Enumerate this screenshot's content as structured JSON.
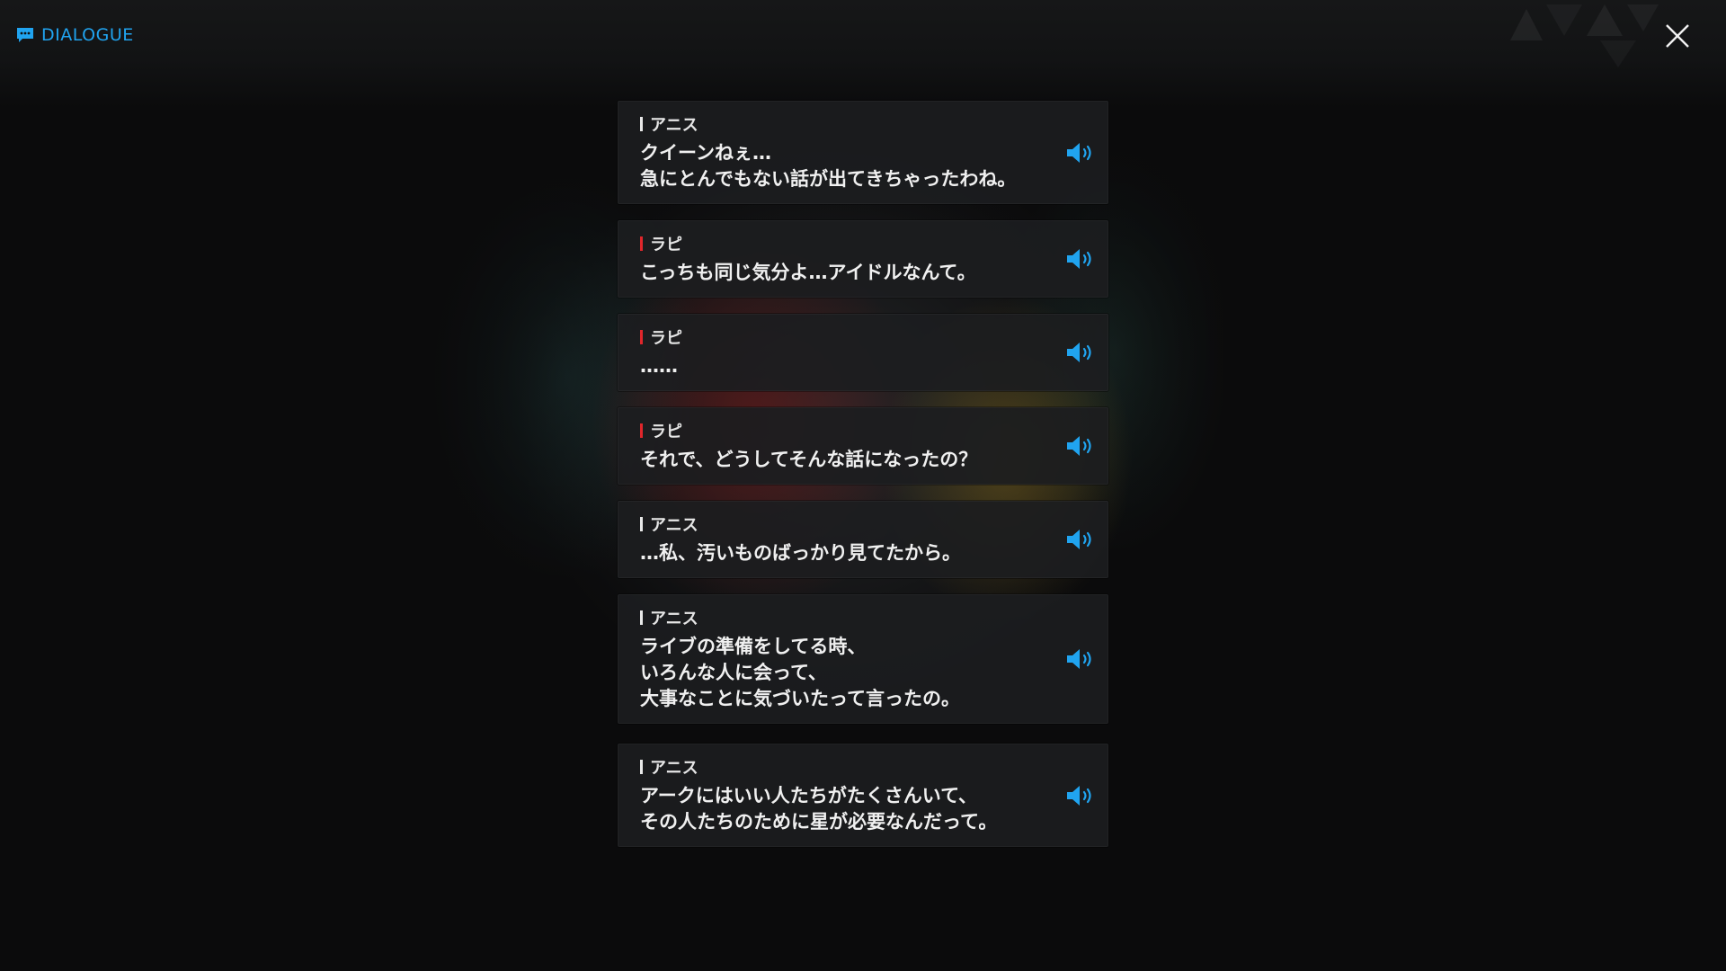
{
  "header": {
    "title": "DIALOGUE",
    "icon": "chat-bubble-icon",
    "accent_color": "#20a4f0"
  },
  "close": {
    "icon": "close-icon"
  },
  "dialogue": [
    {
      "speaker": "アニス",
      "speaker_color": "#e8e8e8",
      "text": "クイーンねぇ…\n急にとんでもない話が出てきちゃったわね。",
      "icon": "speaker-icon"
    },
    {
      "speaker": "ラピ",
      "speaker_color": "#e0262b",
      "text": "こっちも同じ気分よ…アイドルなんて。",
      "icon": "speaker-icon"
    },
    {
      "speaker": "ラピ",
      "speaker_color": "#e0262b",
      "text": "……",
      "icon": "speaker-icon"
    },
    {
      "speaker": "ラピ",
      "speaker_color": "#e0262b",
      "text": "それで、どうしてそんな話になったの？",
      "icon": "speaker-icon"
    },
    {
      "speaker": "アニス",
      "speaker_color": "#e8e8e8",
      "text": "…私、汚いものばっかり見てたから。",
      "icon": "speaker-icon"
    },
    {
      "speaker": "アニス",
      "speaker_color": "#e8e8e8",
      "text": "ライブの準備をしてる時、\nいろんな人に会って、\n大事なことに気づいたって言ったの。",
      "icon": "speaker-icon"
    },
    {
      "speaker": "アニス",
      "speaker_color": "#e8e8e8",
      "text": "アークにはいい人たちがたくさんいて、\nその人たちのために星が必要なんだって。",
      "icon": "speaker-icon"
    }
  ]
}
